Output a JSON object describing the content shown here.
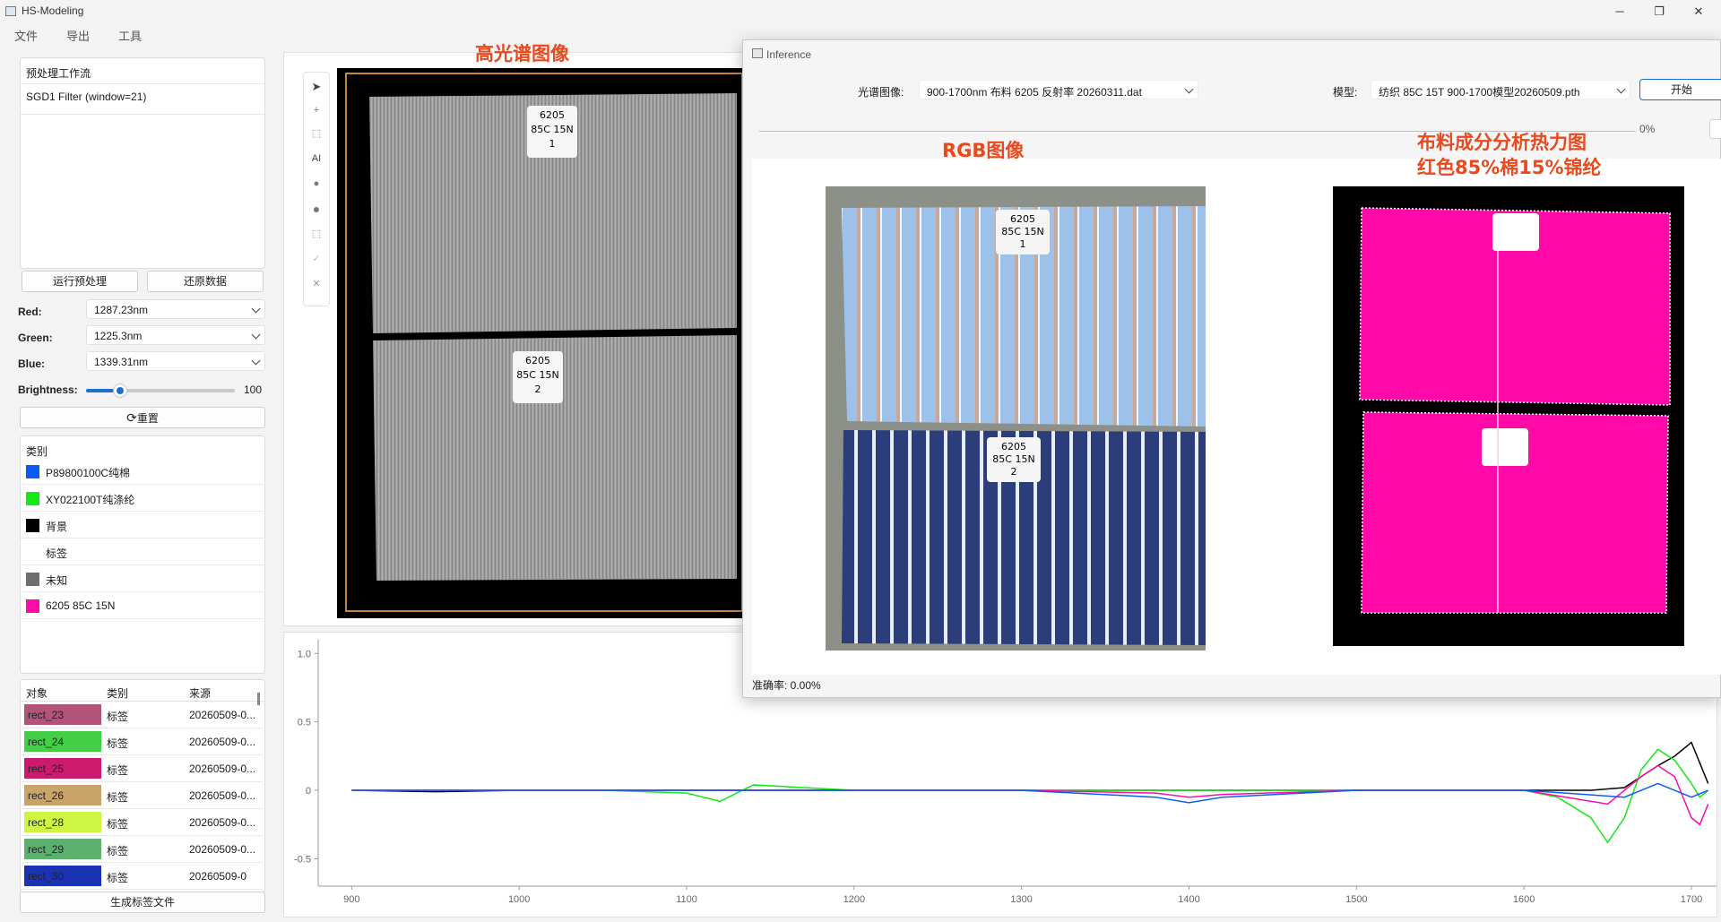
{
  "app": {
    "title": "HS-Modeling"
  },
  "window_controls": {
    "minimize": "─",
    "maximize": "❐",
    "close": "✕"
  },
  "menu": [
    "文件",
    "导出",
    "工具"
  ],
  "left": {
    "workflow_title": "预处理工作流",
    "workflow_items": [
      "SGD1 Filter (window=21)"
    ],
    "run_button": "运行预处理",
    "restore_button": "还原数据",
    "red_label": "Red:",
    "red_value": "1287.23nm",
    "green_label": "Green:",
    "green_value": "1225.3nm",
    "blue_label": "Blue:",
    "blue_value": "1339.31nm",
    "brightness_label": "Brightness:",
    "brightness_value": "100",
    "brightness_level": 0.23,
    "reset_button": "重置",
    "categories_header": "类别",
    "categories": [
      {
        "name": "P89800100C纯棉",
        "color": "#0a5cf5"
      },
      {
        "name": "XY022100T纯涤纶",
        "color": "#16e816"
      },
      {
        "name": "背景",
        "color": "#000000"
      },
      {
        "name": "标签",
        "color": ""
      },
      {
        "name": "未知",
        "color": "#6e6e6e"
      },
      {
        "name": "6205 85C 15N",
        "color": "#ff0aa8"
      }
    ],
    "objects_headers": [
      "对象",
      "类别",
      "来源"
    ],
    "objects": [
      {
        "name": "rect_23",
        "cat": "标签",
        "src": "20260509-0...",
        "color": "#b25479"
      },
      {
        "name": "rect_24",
        "cat": "标签",
        "src": "20260509-0...",
        "color": "#43cf45"
      },
      {
        "name": "rect_25",
        "cat": "标签",
        "src": "20260509-0...",
        "color": "#cc1a6e"
      },
      {
        "name": "rect_26",
        "cat": "标签",
        "src": "20260509-0...",
        "color": "#c9a46a"
      },
      {
        "name": "rect_28",
        "cat": "标签",
        "src": "20260509-0...",
        "color": "#cff543"
      },
      {
        "name": "rect_29",
        "cat": "标签",
        "src": "20260509-0...",
        "color": "#5cb06f"
      },
      {
        "name": "rect_30",
        "cat": "标签",
        "src": "20260509-0",
        "color": "#1a33b5"
      }
    ],
    "generate_button": "生成标签文件"
  },
  "annotations": {
    "hsi": "高光谱图像",
    "rgb": "RGB图像",
    "heat1": "布料成分分析热力图",
    "heat2": "红色85%棉15%锦纶"
  },
  "sample_labels": {
    "top": [
      "6205",
      "85C 15N",
      "1"
    ],
    "bottom": [
      "6205",
      "85C 15N",
      "2"
    ]
  },
  "toolbar": {
    "ai": "AI"
  },
  "inference": {
    "title": "Inference",
    "spectral_label": "光谱图像:",
    "spectral_value": "900-1700nm 布料 6205 反射率 20260311.dat",
    "model_label": "模型:",
    "model_value": "纺织 85C 15T 900-1700模型20260509.pth",
    "start_button": "开始",
    "progress": "0%",
    "progress_fraction": 0,
    "accuracy": "准确率: 0.00%"
  },
  "chart_data": {
    "type": "line",
    "xlim": [
      880,
      1715
    ],
    "ylim": [
      -0.7,
      1.1
    ],
    "xticks": [
      900,
      1000,
      1100,
      1200,
      1300,
      1400,
      1500,
      1600,
      1700
    ],
    "yticks": [
      -0.5,
      0,
      0.5,
      1.0
    ],
    "ytick_labels": [
      "-0.5",
      "0",
      "0.5",
      "1.0"
    ],
    "series": [
      {
        "color": "#000000",
        "x": [
          900,
          950,
          1000,
          1050,
          1100,
          1150,
          1200,
          1250,
          1300,
          1350,
          1400,
          1450,
          1500,
          1550,
          1600,
          1620,
          1640,
          1660,
          1670,
          1680,
          1690,
          1700,
          1705,
          1710
        ],
        "y": [
          0,
          -0.01,
          0,
          0,
          0,
          0,
          0,
          0,
          0,
          0,
          0,
          0,
          0,
          0,
          0,
          0,
          0,
          0.02,
          0.1,
          0.18,
          0.25,
          0.35,
          0.2,
          0.05
        ]
      },
      {
        "color": "#16e816",
        "x": [
          900,
          950,
          1000,
          1050,
          1100,
          1120,
          1140,
          1200,
          1300,
          1400,
          1500,
          1550,
          1600,
          1620,
          1640,
          1650,
          1660,
          1670,
          1680,
          1690,
          1700,
          1705,
          1710
        ],
        "y": [
          0,
          0,
          0,
          0,
          -0.02,
          -0.08,
          0.04,
          0,
          0,
          0,
          0,
          0,
          0,
          -0.05,
          -0.2,
          -0.38,
          -0.2,
          0.15,
          0.3,
          0.22,
          0.05,
          -0.05,
          0
        ]
      },
      {
        "color": "#ff0aa8",
        "x": [
          900,
          1000,
          1100,
          1200,
          1300,
          1380,
          1400,
          1420,
          1500,
          1600,
          1650,
          1670,
          1680,
          1690,
          1700,
          1705,
          1710
        ],
        "y": [
          0,
          0,
          0,
          0,
          0,
          -0.02,
          -0.05,
          -0.03,
          0,
          0,
          -0.1,
          0.1,
          0.18,
          0.1,
          -0.2,
          -0.25,
          -0.1
        ]
      },
      {
        "color": "#0a5cf5",
        "x": [
          900,
          1000,
          1100,
          1200,
          1300,
          1380,
          1400,
          1420,
          1500,
          1600,
          1660,
          1680,
          1690,
          1700,
          1710
        ],
        "y": [
          0,
          0,
          0,
          0,
          0,
          -0.05,
          -0.09,
          -0.05,
          0,
          0,
          -0.05,
          0.05,
          0,
          -0.05,
          0
        ]
      }
    ]
  }
}
